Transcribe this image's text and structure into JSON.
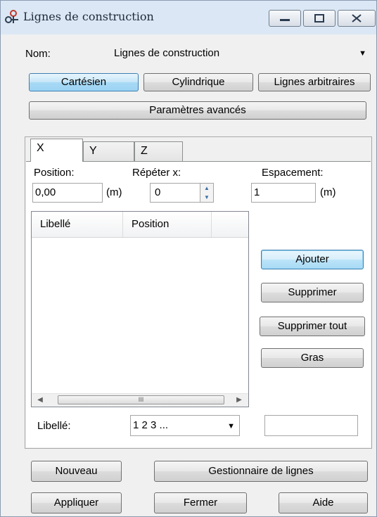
{
  "window": {
    "title": "Lignes de construction"
  },
  "icons": {
    "app": "construction-lines-icon",
    "minimize": "minimize-icon",
    "maximize": "maximize-icon",
    "close": "close-icon"
  },
  "name_row": {
    "label": "Nom:",
    "value": "Lignes de construction"
  },
  "mode_buttons": {
    "cartesian": "Cartésien",
    "cylindrical": "Cylindrique",
    "arbitrary": "Lignes arbitraires",
    "advanced": "Paramètres avancés"
  },
  "tabs": [
    {
      "label": "X"
    },
    {
      "label": "Y"
    },
    {
      "label": "Z"
    }
  ],
  "position": {
    "label": "Position:",
    "value": "0,00",
    "unit": "(m)"
  },
  "repeat": {
    "label": "Répéter x:",
    "value": "0"
  },
  "spacing": {
    "label": "Espacement:",
    "value": "1",
    "unit": "(m)"
  },
  "list": {
    "columns": [
      "Libellé",
      "Position"
    ],
    "rows": []
  },
  "actions": {
    "add": "Ajouter",
    "delete": "Supprimer",
    "delete_all": "Supprimer tout",
    "bold": "Gras"
  },
  "label_row": {
    "label": "Libellé:",
    "value": "1 2 3 ...",
    "text_value": ""
  },
  "footer": {
    "new": "Nouveau",
    "manager": "Gestionnaire de lignes",
    "apply": "Appliquer",
    "close": "Fermer",
    "help": "Aide"
  }
}
